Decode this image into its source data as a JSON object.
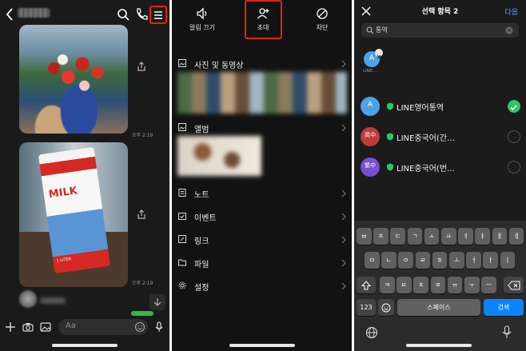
{
  "chat_panel": {
    "bubbles": [
      {
        "time": "오후 2:19"
      },
      {
        "time": "오후 2:19"
      }
    ],
    "milk_carton": {
      "brand": "MILK",
      "volume": "1 LITER"
    },
    "message_input": {
      "placeholder": "Aa"
    }
  },
  "menu_panel": {
    "top_buttons": [
      {
        "label": "알림 끄기",
        "icon": "speaker-icon"
      },
      {
        "label": "초대",
        "icon": "add-person-icon"
      },
      {
        "label": "차단",
        "icon": "block-icon"
      }
    ],
    "items": [
      {
        "label": "사진 및 동영상",
        "icon": "photo-icon"
      },
      {
        "label": "앨범",
        "icon": "album-icon"
      },
      {
        "label": "노트",
        "icon": "note-icon"
      },
      {
        "label": "이벤트",
        "icon": "calendar-icon"
      },
      {
        "label": "링크",
        "icon": "link-icon"
      },
      {
        "label": "파일",
        "icon": "folder-icon"
      },
      {
        "label": "설정",
        "icon": "gear-icon"
      }
    ]
  },
  "invite_panel": {
    "title": "선택 항목 2",
    "done_label": "다음",
    "search_value": "통역",
    "selected_chip": {
      "initial": "A",
      "label": "LINE…"
    },
    "friends": [
      {
        "name": "LINE영어통역",
        "avatar_text": "A",
        "avatar_color": "#4fa2e8",
        "selected": true
      },
      {
        "name": "LINE중국어(간…",
        "avatar_text": "简中",
        "avatar_color": "#c23a3a",
        "selected": false
      },
      {
        "name": "LINE중국어(번…",
        "avatar_text": "繁中",
        "avatar_color": "#7b4fd0",
        "selected": false
      }
    ],
    "keyboard": {
      "row1": [
        "ㅂ",
        "ㅈ",
        "ㄷ",
        "ㄱ",
        "ㅅ",
        "ㅛ",
        "ㅕ",
        "ㅑ",
        "ㅐ",
        "ㅔ"
      ],
      "row2": [
        "ㅁ",
        "ㄴ",
        "ㅇ",
        "ㄹ",
        "ㅎ",
        "ㅗ",
        "ㅓ",
        "ㅏ",
        "ㅣ"
      ],
      "row3": [
        "ㅋ",
        "ㅌ",
        "ㅊ",
        "ㅍ",
        "ㅠ",
        "ㅜ",
        "ㅡ"
      ],
      "num_key": "123",
      "space_label": "스페이스",
      "search_label": "검색"
    }
  },
  "colors": {
    "highlight": "#e0241b",
    "accent_blue": "#0a84ff",
    "line_green": "#2fc56a"
  }
}
